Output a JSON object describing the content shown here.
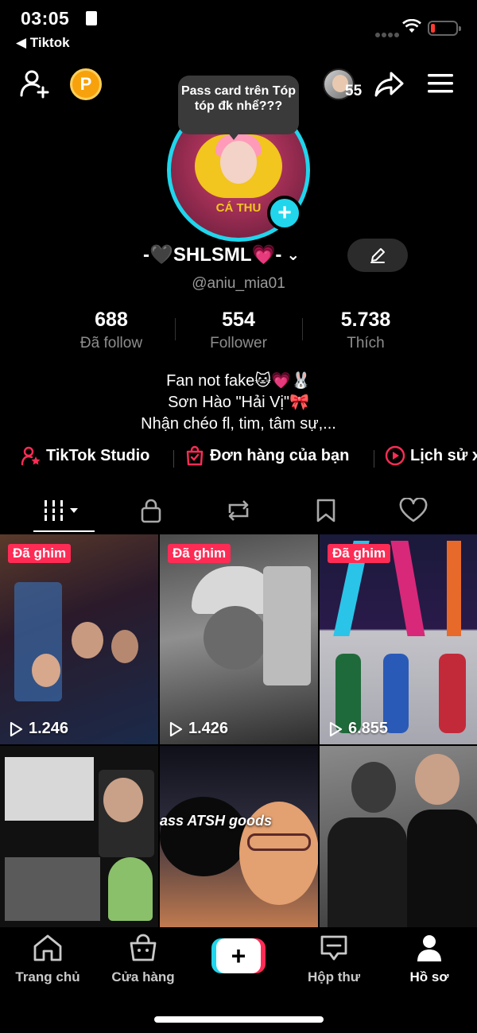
{
  "status_bar": {
    "time": "03:05",
    "back_label": "◀ Tiktok"
  },
  "top_bar": {
    "coin_label": "P",
    "profile_views": "55"
  },
  "note": {
    "text": "Pass card trên Tóp tóp đk nhể???"
  },
  "avatar": {
    "caption": "CÁ THU"
  },
  "profile": {
    "display_name": "-🖤SHLSML💗-",
    "username": "@aniu_mia01"
  },
  "stats": [
    {
      "value": "688",
      "label": "Đã follow"
    },
    {
      "value": "554",
      "label": "Follower"
    },
    {
      "value": "5.738",
      "label": "Thích"
    }
  ],
  "bio": [
    "Fan not fake🐱💗🐰",
    "Sơn Hào \"Hải Vị\"🎀",
    "Nhận chéo fl, tim, tâm sự,..."
  ],
  "quick_links": [
    {
      "label": "TikTok Studio",
      "icon": "person-star-icon"
    },
    {
      "label": "Đơn hàng của bạn",
      "icon": "shopping-bag-icon"
    },
    {
      "label": "Lịch sử xem",
      "icon": "play-circle-icon"
    }
  ],
  "tabs": [
    {
      "name": "videos",
      "icon": "grid-icon",
      "active": true
    },
    {
      "name": "private",
      "icon": "lock-icon"
    },
    {
      "name": "reposts",
      "icon": "repost-icon"
    },
    {
      "name": "favorites",
      "icon": "bookmark-icon"
    },
    {
      "name": "liked",
      "icon": "heart-icon"
    }
  ],
  "videos": [
    {
      "pinned_label": "Đã ghim",
      "views": "1.246",
      "colors": [
        "#3a2a2a",
        "#7a5a4a",
        "#1a2a4a"
      ]
    },
    {
      "pinned_label": "Đã ghim",
      "views": "1.426",
      "colors": [
        "#2a2a2a",
        "#8a8a8a",
        "#3a3a3a"
      ]
    },
    {
      "pinned_label": "Đã ghim",
      "views": "6.855",
      "colors": [
        "#1a1a3a",
        "#8a2a6a",
        "#2a6a8a"
      ]
    },
    {
      "colors": [
        "#1a1a1a",
        "#dadada",
        "#2a2a2a"
      ]
    },
    {
      "overlay_text": "ass ATSH goods",
      "colors": [
        "#1a1a2a",
        "#c98a5a",
        "#4a3a2a"
      ]
    },
    {
      "colors": [
        "#2a2a2a",
        "#9a9a9a",
        "#3a3a3a"
      ]
    }
  ],
  "bottom_nav": [
    {
      "label": "Trang chủ",
      "icon": "home-icon"
    },
    {
      "label": "Cửa hàng",
      "icon": "shop-icon"
    },
    {
      "label": "",
      "icon": "create-plus-icon"
    },
    {
      "label": "Hộp thư",
      "icon": "inbox-icon"
    },
    {
      "label": "Hồ sơ",
      "icon": "profile-icon",
      "active": true
    }
  ],
  "colors": {
    "accent_cyan": "#20d5ec",
    "accent_red": "#fe2c55",
    "background": "#000000"
  }
}
